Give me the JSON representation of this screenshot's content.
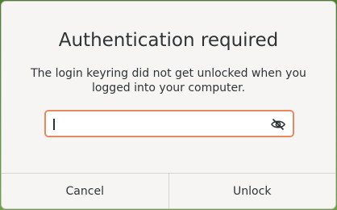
{
  "dialog": {
    "title": "Authentication required",
    "message_line1": "The login keyring did not get unlocked when you",
    "message_line2": "logged into your computer.",
    "password_value": "",
    "eye_icon": "eye-slash-icon",
    "cancel_label": "Cancel",
    "unlock_label": "Unlock"
  },
  "colors": {
    "focus_border": "#e9885f",
    "dialog_bg": "#f6f5f4",
    "text": "#2e3436"
  }
}
